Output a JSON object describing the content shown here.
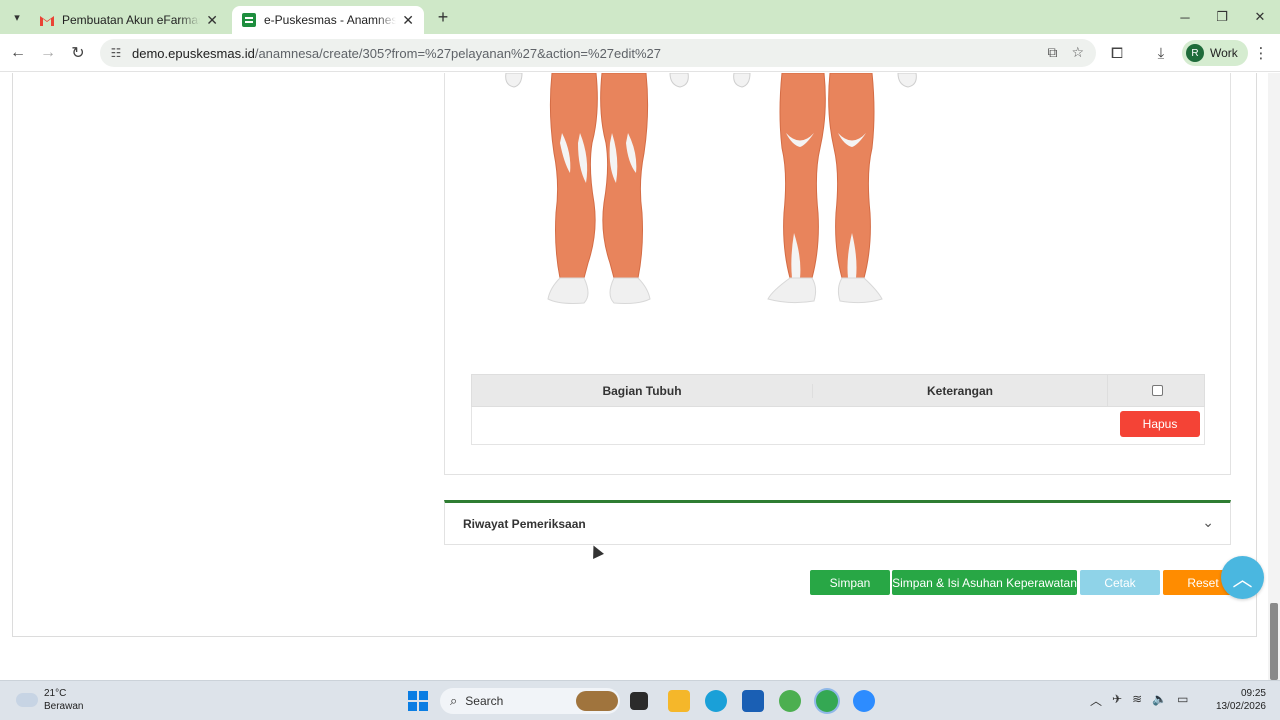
{
  "browser": {
    "tabs": [
      {
        "title": "Pembuatan Akun eFarmasi Kab",
        "icon": "gmail-icon",
        "active": false
      },
      {
        "title": "e-Puskesmas - Anamnesa - Bua",
        "icon": "epuskesmas-icon",
        "active": true
      }
    ],
    "url_host": "demo.epuskesmas.id",
    "url_path": "/anamnesa/create/305?from=%27pelayanan%27&action=%27edit%27",
    "profile_initial": "R",
    "profile_label": "Work"
  },
  "body_table": {
    "col_bagian": "Bagian Tubuh",
    "col_keterangan": "Keterangan",
    "delete_label": "Hapus"
  },
  "accordion": {
    "title": "Riwayat Pemeriksaan"
  },
  "actions": {
    "save": "Simpan",
    "save_nursing": "Simpan & Isi Asuhan Keperawatan",
    "print": "Cetak",
    "reset": "Reset"
  },
  "taskbar": {
    "temperature": "21°C",
    "weather": "Berawan",
    "search_label": "Search",
    "time": "09:25",
    "date": "13/02/2026"
  },
  "colors": {
    "accent_green": "#28a745",
    "danger": "#f44336",
    "info_light": "#8fd3e8",
    "warning": "#ff8c00",
    "muscle": "#e8845c"
  }
}
